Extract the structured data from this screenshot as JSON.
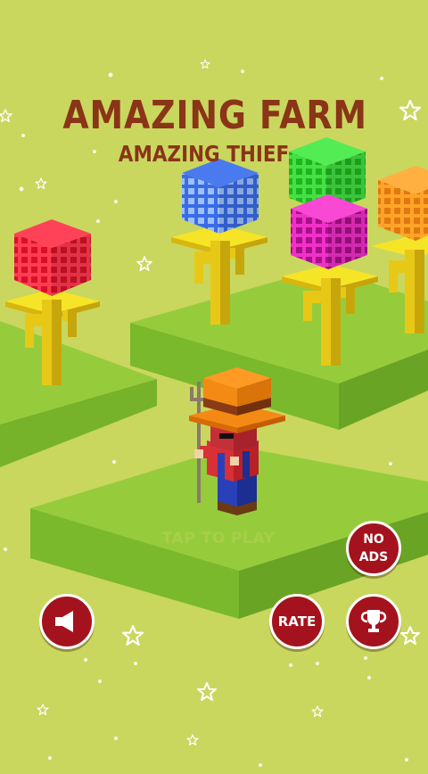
{
  "title": {
    "main": "AMAZING FARM",
    "sub": "AMAZING THIEF"
  },
  "prompt": {
    "tap_to_play": "TAP TO PLAY"
  },
  "buttons": {
    "sound": {
      "icon": "speaker-icon"
    },
    "rate": {
      "label": "RATE"
    },
    "trophy": {
      "icon": "trophy-icon"
    },
    "no_ads": {
      "line1": "NO",
      "line2": "ADS"
    }
  },
  "colors": {
    "background": "#c9d75e",
    "title": "#8a3418",
    "button": "#a4131d",
    "grass_top": "#96cc3c",
    "grass_side": "#76b22a",
    "flower_stem": "#f2d81c",
    "cube_red": "#f0213a",
    "cube_blue": "#2f5fd6",
    "cube_green": "#3cd43c",
    "cube_magenta": "#e020b8",
    "cube_orange": "#ff9a1a"
  }
}
